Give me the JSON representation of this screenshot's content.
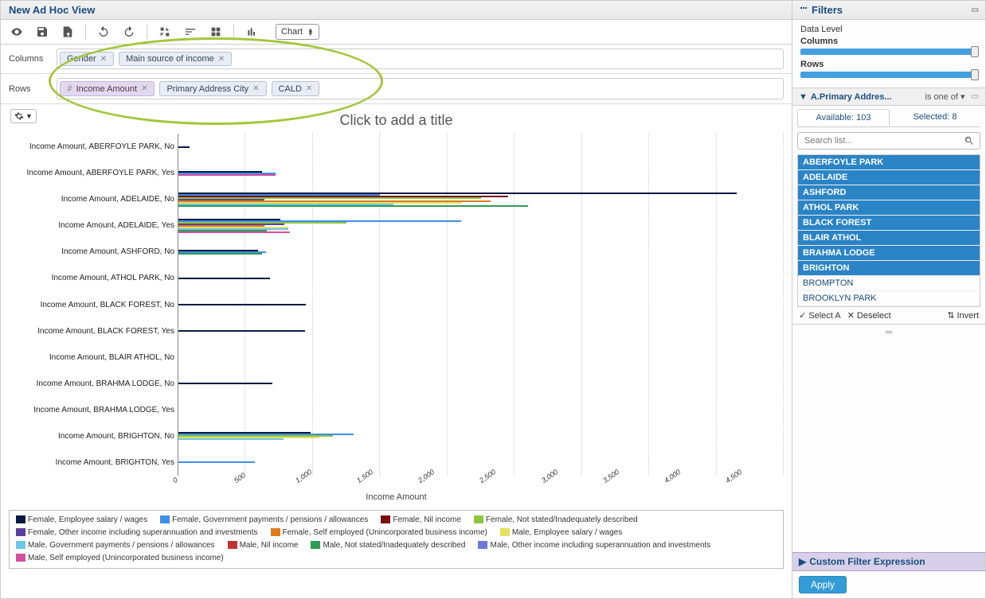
{
  "title": "New Ad Hoc View",
  "chart_type": "Chart",
  "columns_label": "Columns",
  "rows_label": "Rows",
  "columns_chips": [
    {
      "label": "Gender"
    },
    {
      "label": "Main source of income"
    }
  ],
  "rows_chips": [
    {
      "label": "Income Amount",
      "hash": "#",
      "kind": "purple"
    },
    {
      "label": "Primary Address City"
    },
    {
      "label": "CALD"
    }
  ],
  "title_placeholder": "Click to add a title",
  "chart_data": {
    "type": "bar",
    "orientation": "horizontal",
    "xlabel": "Income Amount",
    "xlim": [
      0,
      4500
    ],
    "xticks": [
      "0",
      "500",
      "1,000",
      "1,500",
      "2,000",
      "2,500",
      "3,000",
      "3,500",
      "4,000",
      "4,500"
    ],
    "categories": [
      "Income Amount, ABERFOYLE PARK, No",
      "Income Amount, ABERFOYLE PARK, Yes",
      "Income Amount, ADELAIDE, No",
      "Income Amount, ADELAIDE, Yes",
      "Income Amount, ASHFORD, No",
      "Income Amount, ATHOL PARK, No",
      "Income Amount, BLACK FOREST, No",
      "Income Amount, BLACK FOREST, Yes",
      "Income Amount, BLAIR ATHOL, No",
      "Income Amount, BRAHMA LODGE, No",
      "Income Amount, BRAHMA LODGE, Yes",
      "Income Amount, BRIGHTON, No",
      "Income Amount, BRIGHTON, Yes"
    ],
    "series": [
      {
        "name": "Female, Employee salary / wages",
        "color": "#0a1a45",
        "values": [
          80,
          620,
          4150,
          760,
          590,
          680,
          950,
          940,
          0,
          700,
          0,
          980,
          0
        ]
      },
      {
        "name": "Female, Government payments / pensions / allowances",
        "color": "#3f8ee8",
        "values": [
          0,
          720,
          1500,
          2100,
          650,
          0,
          0,
          0,
          0,
          0,
          0,
          1300,
          570
        ]
      },
      {
        "name": "Female, Nil income",
        "color": "#7a1010",
        "values": [
          0,
          0,
          2450,
          0,
          0,
          0,
          0,
          0,
          0,
          0,
          0,
          0,
          0
        ]
      },
      {
        "name": "Female, Not stated/Inadequately described",
        "color": "#8cc63f",
        "values": [
          0,
          0,
          2250,
          1250,
          0,
          0,
          0,
          0,
          0,
          0,
          0,
          1150,
          0
        ]
      },
      {
        "name": "Female, Other income including superannuation and investments",
        "color": "#5a3fa0",
        "values": [
          0,
          0,
          640,
          790,
          0,
          0,
          0,
          0,
          0,
          0,
          0,
          0,
          0
        ]
      },
      {
        "name": "Female, Self employed (Unincorporated business income)",
        "color": "#e07a20",
        "values": [
          0,
          0,
          2320,
          640,
          0,
          0,
          0,
          0,
          0,
          0,
          0,
          0,
          0
        ]
      },
      {
        "name": "Male, Employee salary / wages",
        "color": "#e6e060",
        "values": [
          0,
          0,
          2100,
          820,
          0,
          0,
          0,
          0,
          0,
          0,
          0,
          1050,
          0
        ]
      },
      {
        "name": "Male, Government payments / pensions / allowances",
        "color": "#6bc8e8",
        "values": [
          0,
          0,
          1600,
          820,
          0,
          0,
          0,
          0,
          0,
          0,
          0,
          780,
          0
        ]
      },
      {
        "name": "Male, Nil income",
        "color": "#c43030",
        "values": [
          0,
          0,
          0,
          0,
          0,
          0,
          0,
          0,
          0,
          0,
          0,
          0,
          0
        ]
      },
      {
        "name": "Male, Not stated/Inadequately described",
        "color": "#2e9a55",
        "values": [
          0,
          0,
          2600,
          660,
          620,
          0,
          0,
          0,
          0,
          0,
          0,
          0,
          0
        ]
      },
      {
        "name": "Male, Other income including superannuation and investments",
        "color": "#6a7ad6",
        "values": [
          0,
          0,
          0,
          0,
          0,
          0,
          0,
          0,
          0,
          0,
          0,
          0,
          0
        ]
      },
      {
        "name": "Male, Self employed (Unincorporated business income)",
        "color": "#d44fa0",
        "values": [
          0,
          720,
          0,
          830,
          0,
          0,
          0,
          0,
          0,
          0,
          0,
          0,
          0
        ]
      }
    ]
  },
  "sidebar": {
    "filters_title": "Filters",
    "data_level": "Data Level",
    "columns": "Columns",
    "rows": "Rows",
    "filter_name": "A.Primary Addres...",
    "filter_op": "is one of",
    "available": "Available: 103",
    "selected": "Selected: 8",
    "search_placeholder": "Search list...",
    "list": [
      {
        "label": "ABERFOYLE PARK",
        "sel": true
      },
      {
        "label": "ADELAIDE",
        "sel": true
      },
      {
        "label": "ASHFORD",
        "sel": true
      },
      {
        "label": "ATHOL PARK",
        "sel": true
      },
      {
        "label": "BLACK FOREST",
        "sel": true
      },
      {
        "label": "BLAIR ATHOL",
        "sel": true
      },
      {
        "label": "BRAHMA LODGE",
        "sel": true
      },
      {
        "label": "BRIGHTON",
        "sel": true
      },
      {
        "label": "BROMPTON",
        "sel": false
      },
      {
        "label": "BROOKLYN PARK",
        "sel": false
      }
    ],
    "select_all": "Select A",
    "deselect": "Deselect",
    "invert": "Invert",
    "custom": "Custom Filter Expression",
    "apply": "Apply"
  }
}
